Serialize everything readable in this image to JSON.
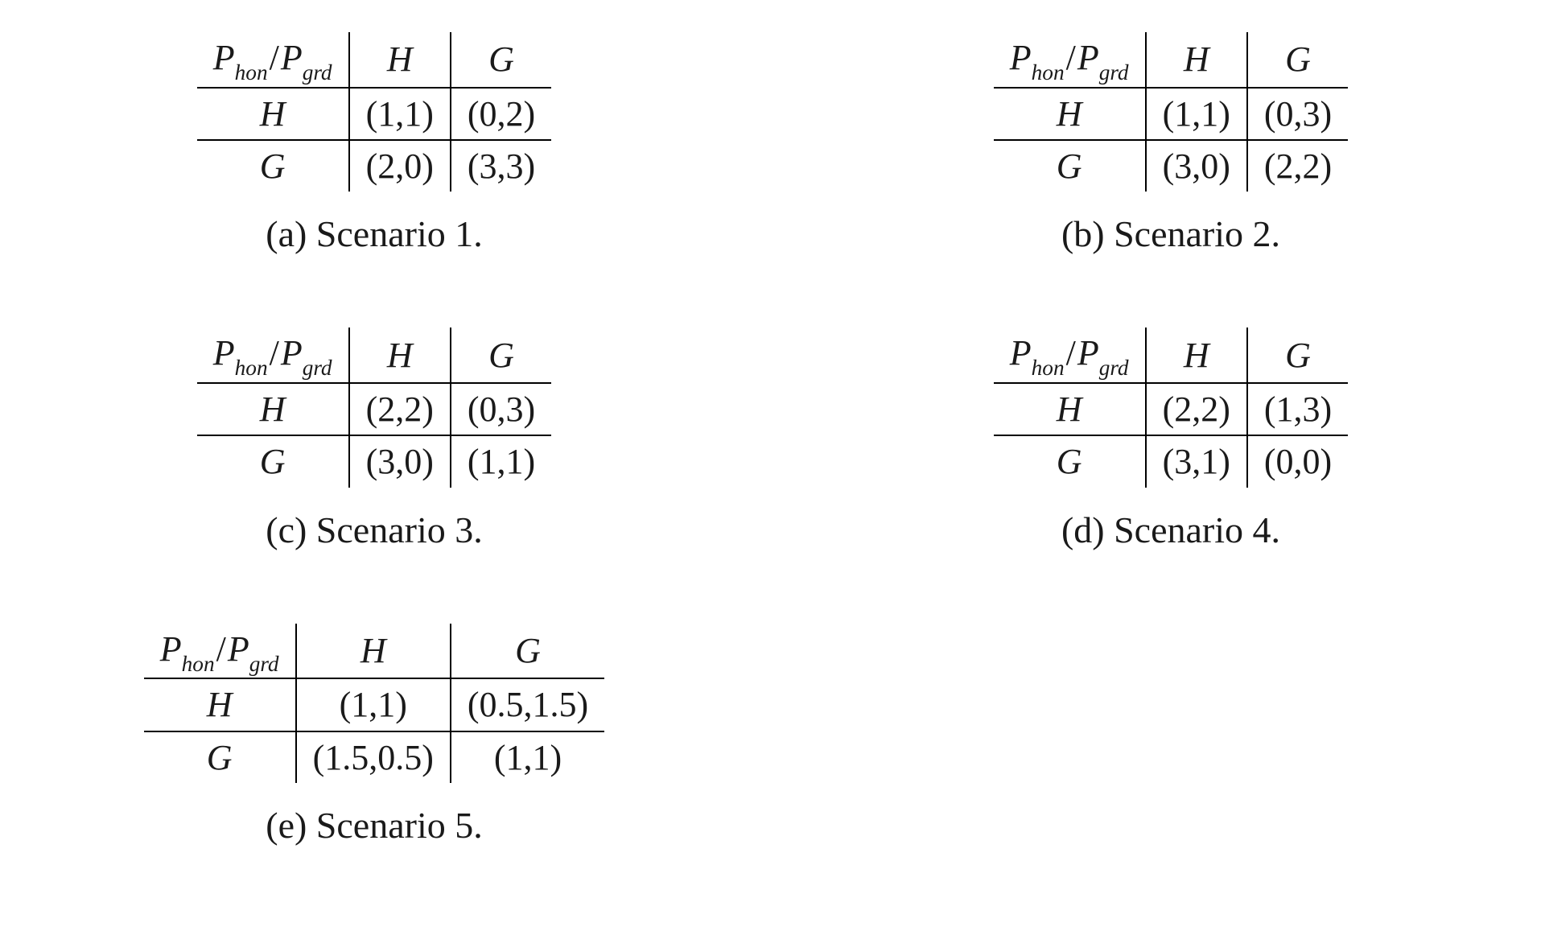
{
  "chart_data": [
    {
      "type": "table",
      "caption": "(a) Scenario 1.",
      "row_label": "P_hon",
      "col_label": "P_grd",
      "rows": [
        "H",
        "G"
      ],
      "cols": [
        "H",
        "G"
      ],
      "cells": [
        [
          "(1,1)",
          "(0,2)"
        ],
        [
          "(2,0)",
          "(3,3)"
        ]
      ]
    },
    {
      "type": "table",
      "caption": "(b) Scenario 2.",
      "row_label": "P_hon",
      "col_label": "P_grd",
      "rows": [
        "H",
        "G"
      ],
      "cols": [
        "H",
        "G"
      ],
      "cells": [
        [
          "(1,1)",
          "(0,3)"
        ],
        [
          "(3,0)",
          "(2,2)"
        ]
      ]
    },
    {
      "type": "table",
      "caption": "(c) Scenario 3.",
      "row_label": "P_hon",
      "col_label": "P_grd",
      "rows": [
        "H",
        "G"
      ],
      "cols": [
        "H",
        "G"
      ],
      "cells": [
        [
          "(2,2)",
          "(0,3)"
        ],
        [
          "(3,0)",
          "(1,1)"
        ]
      ]
    },
    {
      "type": "table",
      "caption": "(d) Scenario 4.",
      "row_label": "P_hon",
      "col_label": "P_grd",
      "rows": [
        "H",
        "G"
      ],
      "cols": [
        "H",
        "G"
      ],
      "cells": [
        [
          "(2,2)",
          "(1,3)"
        ],
        [
          "(3,1)",
          "(0,0)"
        ]
      ]
    },
    {
      "type": "table",
      "caption": "(e) Scenario 5.",
      "row_label": "P_hon",
      "col_label": "P_grd",
      "rows": [
        "H",
        "G"
      ],
      "cols": [
        "H",
        "G"
      ],
      "cells": [
        [
          "(1,1)",
          "(0.5,1.5)"
        ],
        [
          "(1.5,0.5)",
          "(1,1)"
        ]
      ]
    }
  ]
}
